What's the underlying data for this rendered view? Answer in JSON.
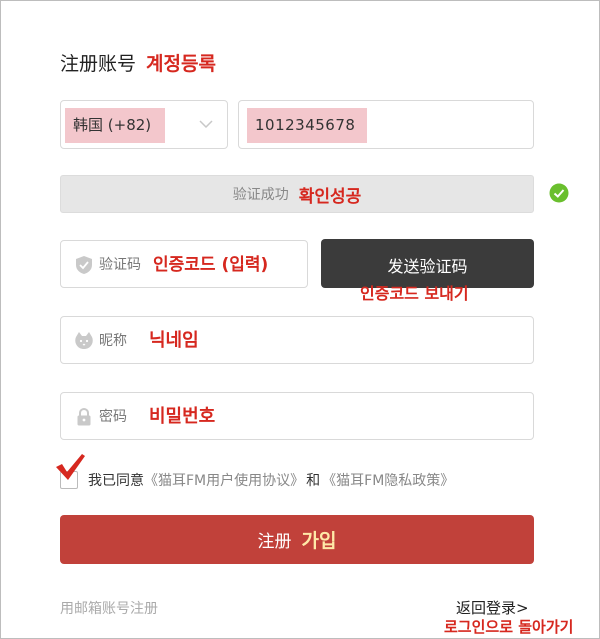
{
  "header": {
    "title": "注册账号",
    "title_note": "계정등록"
  },
  "phone_section": {
    "country_value": "韩国 (+82)",
    "phone_value": "1012345678"
  },
  "verification": {
    "status_text": "验证成功",
    "status_note": "확인성공"
  },
  "code": {
    "placeholder": "验证码",
    "note": "인증코드 (입력)",
    "send_button": "发送验证码",
    "send_note": "인증코드 보내기"
  },
  "nickname": {
    "placeholder": "昵称",
    "note": "닉네임"
  },
  "password": {
    "placeholder": "密码",
    "note": "비밀번호"
  },
  "agreement": {
    "lead": "我已同意",
    "terms": "《猫耳FM用户使用协议》",
    "and": "和",
    "privacy": "《猫耳FM隐私政策》"
  },
  "register": {
    "label": "注册",
    "note": "가입"
  },
  "footer": {
    "email_register": "用邮箱账号注册",
    "back_login": "返回登录>",
    "back_note": "로그인으로 돌아가기"
  },
  "colors": {
    "accent_red": "#c1413a",
    "highlight_pink": "#f3c7cc",
    "success_green": "#6abf2e",
    "note_red": "#d6281f",
    "send_button_bg": "#3b3b3b"
  },
  "icons": [
    "chevron-down-icon",
    "check-circle-icon",
    "shield-icon",
    "cat-face-icon",
    "lock-icon",
    "checkmark-icon"
  ]
}
